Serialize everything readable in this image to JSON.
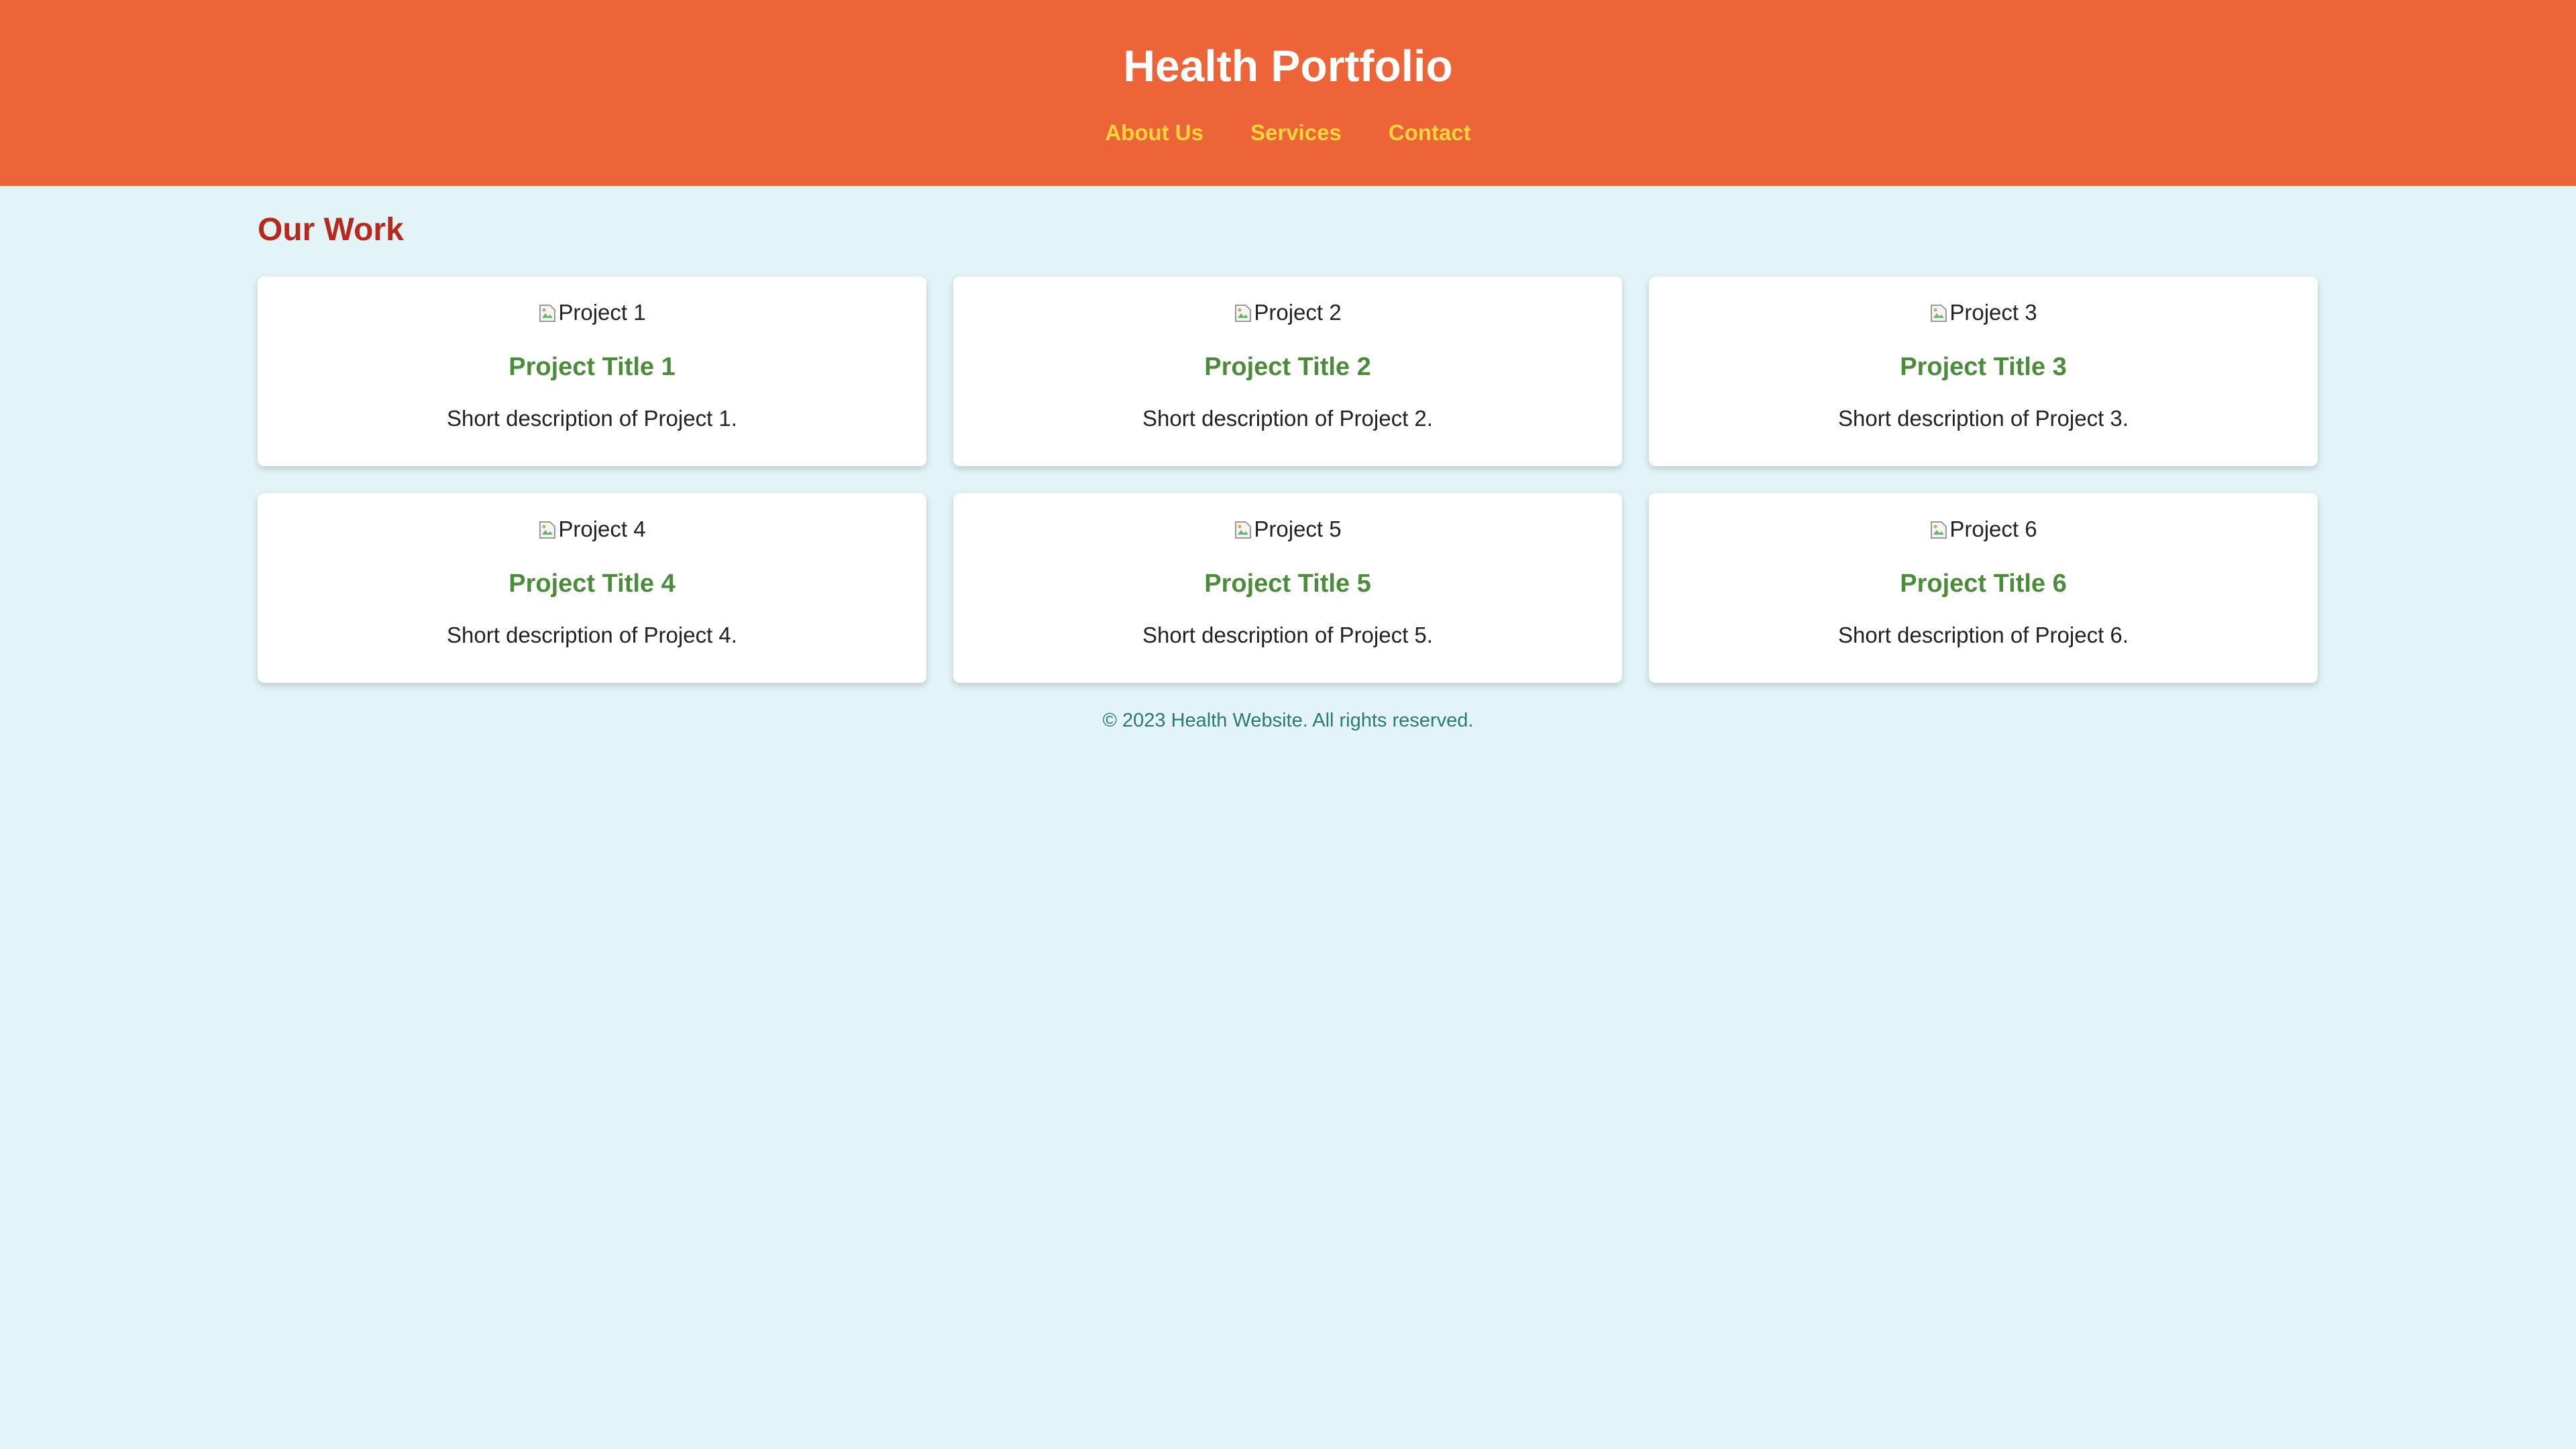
{
  "header": {
    "title": "Health Portfolio",
    "nav": [
      "About Us",
      "Services",
      "Contact"
    ]
  },
  "main": {
    "section_title": "Our Work",
    "projects": [
      {
        "image_alt": "Project 1",
        "title": "Project Title 1",
        "description": "Short description of Project 1."
      },
      {
        "image_alt": "Project 2",
        "title": "Project Title 2",
        "description": "Short description of Project 2."
      },
      {
        "image_alt": "Project 3",
        "title": "Project Title 3",
        "description": "Short description of Project 3."
      },
      {
        "image_alt": "Project 4",
        "title": "Project Title 4",
        "description": "Short description of Project 4."
      },
      {
        "image_alt": "Project 5",
        "title": "Project Title 5",
        "description": "Short description of Project 5."
      },
      {
        "image_alt": "Project 6",
        "title": "Project Title 6",
        "description": "Short description of Project 6."
      }
    ]
  },
  "footer": {
    "text": "© 2023 Health Website. All rights reserved."
  },
  "colors": {
    "header_bg": "#ec6438",
    "page_bg": "#e2f4f8",
    "nav_link": "#ffd63a",
    "section_title": "#b9281c",
    "card_title": "#4a8c3a",
    "footer_text": "#2a7a6e"
  },
  "icons": {
    "card_image": "broken-image-icon"
  }
}
